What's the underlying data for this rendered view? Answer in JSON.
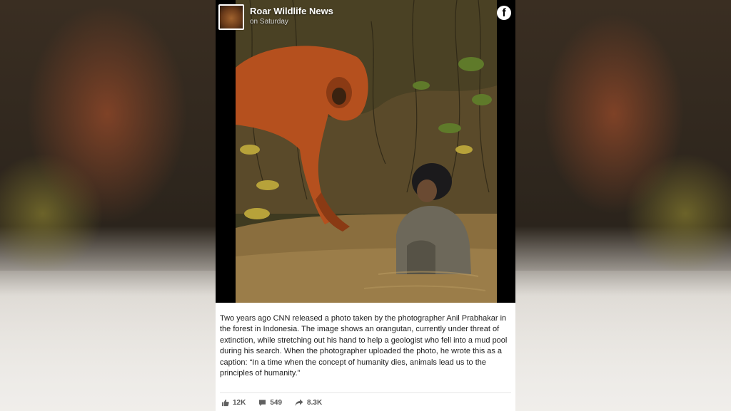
{
  "post": {
    "page_name": "Roar Wildlife News",
    "time": "on Saturday",
    "caption": "Two years ago CNN released a photo taken by the photographer Anil Prabhakar in the forest in Indonesia. The image shows an orangutan, currently under threat of extinction, while stretching out his hand to help a geologist who fell into a mud pool during his search. When the photographer uploaded the photo, he wrote this as a caption: “In a time when the concept of humanity dies, animals lead us to the principles of humanity.”",
    "likes": "12K",
    "comments": "549",
    "shares": "8.3K",
    "logo_glyph": "f"
  },
  "icons": {
    "logo": "facebook-icon",
    "like": "thumbs-up-icon",
    "comment": "comment-icon",
    "share": "share-arrow-icon"
  },
  "colors": {
    "card_bg": "#000000",
    "caption_bg": "#ffffff",
    "text": "#1d1d1d",
    "meta_text": "#555555"
  }
}
